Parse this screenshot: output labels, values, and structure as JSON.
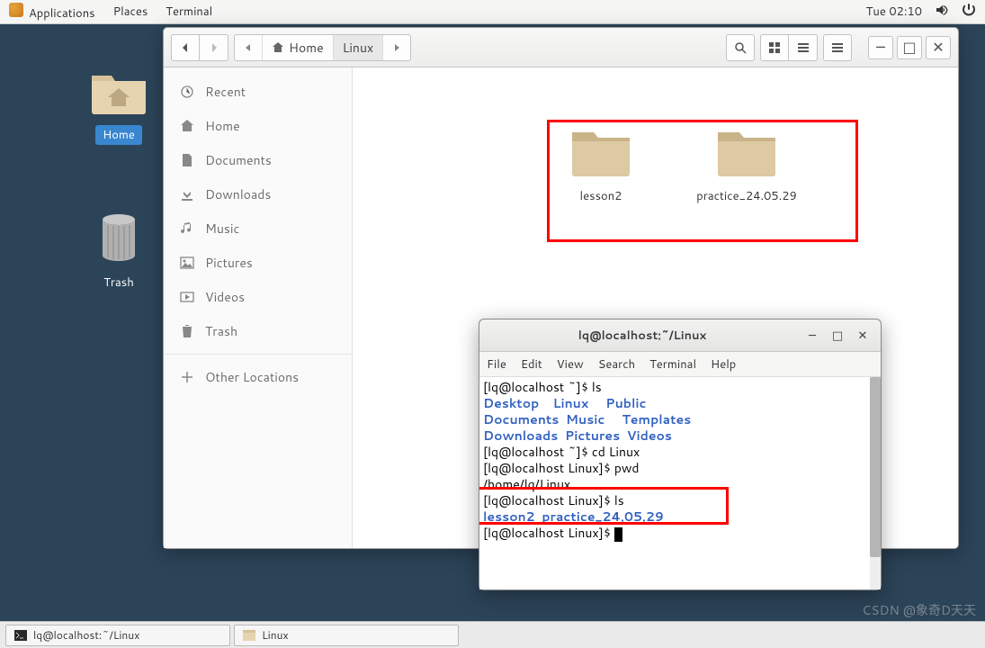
{
  "topbar": {
    "applications": "Applications",
    "places": "Places",
    "terminal": "Terminal",
    "clock": "Tue 02:10"
  },
  "desktop": {
    "home_label": "Home",
    "trash_label": "Trash"
  },
  "fm": {
    "path_home": "Home",
    "path_current": "Linux",
    "sidebar": {
      "recent": "Recent",
      "home": "Home",
      "documents": "Documents",
      "downloads": "Downloads",
      "music": "Music",
      "pictures": "Pictures",
      "videos": "Videos",
      "trash": "Trash",
      "other": "Other Locations"
    },
    "folders": [
      {
        "name": "lesson2"
      },
      {
        "name": "practice_24.05.29"
      }
    ]
  },
  "terminal": {
    "title": "lq@localhost:~/Linux",
    "menu": {
      "file": "File",
      "edit": "Edit",
      "view": "View",
      "search": "Search",
      "terminal": "Terminal",
      "help": "Help"
    },
    "lines": {
      "l1_prompt": "[lq@localhost ~]$ ",
      "l1_cmd": "ls",
      "l2_dirs_a": "Desktop    Linux     Public",
      "l3_dirs_a": "Documents  Music     Templates",
      "l4_dirs_a": "Downloads  Pictures  Videos",
      "l5_prompt": "[lq@localhost ~]$ ",
      "l5_cmd": "cd Linux",
      "l6_prompt": "[lq@localhost Linux]$ ",
      "l6_cmd": "pwd",
      "l7": "/home/lq/Linux",
      "l8_prompt": "[lq@localhost Linux]$ ",
      "l8_cmd": "ls",
      "l9_dirs": "lesson2  practice_24.05.29",
      "l10_prompt": "[lq@localhost Linux]$ "
    }
  },
  "taskbar": {
    "task1": "lq@localhost:~/Linux",
    "task2": "Linux"
  },
  "watermark": "CSDN @象奇D天天"
}
